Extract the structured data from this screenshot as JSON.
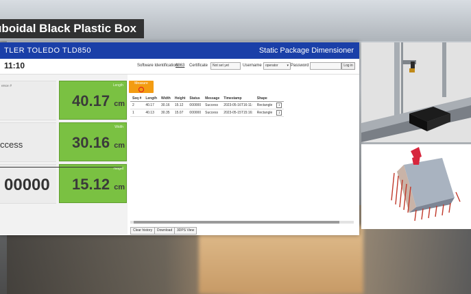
{
  "banner": {
    "title": "uboidal Black Plastic Box"
  },
  "header": {
    "brand": "TLER TOLEDO  TLD850",
    "product": "Static Package Dimensioner"
  },
  "toolbar": {
    "time": "11:10",
    "software_id_label": "Software Identification:",
    "software_id_value": "8863",
    "certificate_label": "Certificate",
    "certificate_value": "Not set yet",
    "username_label": "Username",
    "username_value": "operator",
    "password_label": "Password",
    "login_label": "Log in"
  },
  "left": {
    "card1_small": "ence #",
    "card2_text": "ccess",
    "card3_text": "00000"
  },
  "dims": {
    "length_caption": "Length",
    "length_value": "40.17",
    "width_caption": "Width",
    "width_value": "30.16",
    "height_caption": "Height",
    "height_value": "15.12",
    "unit": "cm"
  },
  "measure": {
    "label": "Measure"
  },
  "log": {
    "headers": [
      "Seq #",
      "Length",
      "Width",
      "Height",
      "Status",
      "Message",
      "Timestamp",
      "Shape"
    ],
    "rows": [
      [
        "2",
        "40.17",
        "30.16",
        "15.12",
        "000000",
        "Success",
        "2023-05-16T16:11:",
        "Rectangle"
      ],
      [
        "1",
        "40.13",
        "30.35",
        "15.07",
        "000000",
        "Success",
        "2023-05-15T15:16:",
        "Rectangle"
      ]
    ]
  },
  "footer": {
    "clear_label": "Clear history",
    "download_label": "Download",
    "view_label": "3DPS View"
  },
  "colors": {
    "header_blue": "#1a3fa8",
    "dimension_green": "#7ac142",
    "measure_orange": "#f39c12"
  }
}
